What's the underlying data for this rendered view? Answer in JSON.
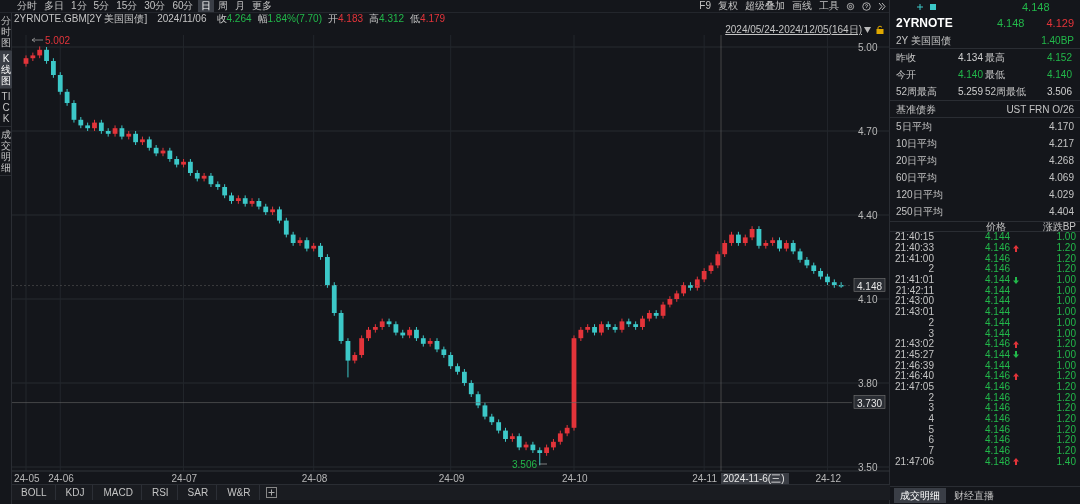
{
  "toolbar": {
    "periods": [
      {
        "label": "分时",
        "selected": false
      },
      {
        "label": "多日",
        "selected": false
      },
      {
        "label": "1分",
        "selected": false
      },
      {
        "label": "5分",
        "selected": false
      },
      {
        "label": "15分",
        "selected": false
      },
      {
        "label": "30分",
        "selected": false
      },
      {
        "label": "60分",
        "selected": false
      },
      {
        "label": "日",
        "selected": true
      },
      {
        "label": "周",
        "selected": false
      },
      {
        "label": "月",
        "selected": false
      },
      {
        "label": "更多",
        "selected": false
      }
    ],
    "tools": [
      "F9",
      "复权",
      "超级叠加",
      "画线",
      "工具"
    ]
  },
  "side_tabs": [
    {
      "label": "分时图",
      "selected": false
    },
    {
      "label": "K线图",
      "selected": true
    },
    {
      "label": "TICK",
      "selected": false
    },
    {
      "label": "成交明细",
      "selected": false
    }
  ],
  "quote_line": {
    "symbol": "2YRNOTE.GBM[2Y 美国国债]",
    "date": "2024/11/06",
    "fields": [
      {
        "label": "收",
        "value": "4.264",
        "color": "#22b84a"
      },
      {
        "label": "幅",
        "value": "1.84%(7.70)",
        "color": "#22b84a"
      },
      {
        "label": "开",
        "value": "4.183",
        "color": "#e3343a"
      },
      {
        "label": "高",
        "value": "4.312",
        "color": "#22b84a"
      },
      {
        "label": "低",
        "value": "4.179",
        "color": "#e3343a"
      }
    ]
  },
  "range_label": "2024/05/24-2024/12/05(164日)",
  "chart": {
    "chart_data": {
      "type": "candlestick",
      "categories": [
        "24-05",
        null,
        null,
        null,
        null,
        "24-06",
        null,
        null,
        null,
        null,
        null,
        null,
        null,
        null,
        null,
        null,
        null,
        null,
        null,
        null,
        null,
        null,
        null,
        "24-07",
        null,
        null,
        null,
        null,
        null,
        null,
        null,
        null,
        null,
        null,
        null,
        null,
        null,
        null,
        null,
        null,
        null,
        null,
        "24-08",
        null,
        null,
        null,
        null,
        null,
        null,
        null,
        null,
        null,
        null,
        null,
        null,
        null,
        null,
        null,
        null,
        null,
        null,
        null,
        "24-09",
        null,
        null,
        null,
        null,
        null,
        null,
        null,
        null,
        null,
        null,
        null,
        null,
        null,
        null,
        null,
        null,
        null,
        "24-10",
        null,
        null,
        null,
        null,
        null,
        null,
        null,
        null,
        null,
        null,
        null,
        null,
        null,
        null,
        null,
        null,
        null,
        null,
        "24-11",
        null,
        null,
        null,
        null,
        null,
        null,
        null,
        null,
        null,
        null,
        null,
        null,
        null,
        null,
        null,
        null,
        null,
        "24-12",
        null,
        null
      ],
      "ohlc": [
        [
          4.94,
          4.97,
          4.93,
          4.96
        ],
        [
          4.96,
          4.98,
          4.95,
          4.97
        ],
        [
          4.97,
          5.002,
          4.96,
          4.99
        ],
        [
          4.99,
          5.0,
          4.94,
          4.95
        ],
        [
          4.95,
          4.96,
          4.89,
          4.9
        ],
        [
          4.9,
          4.91,
          4.83,
          4.84
        ],
        [
          4.84,
          4.85,
          4.79,
          4.8
        ],
        [
          4.8,
          4.81,
          4.73,
          4.74
        ],
        [
          4.74,
          4.75,
          4.71,
          4.72
        ],
        [
          4.72,
          4.73,
          4.7,
          4.71
        ],
        [
          4.71,
          4.74,
          4.7,
          4.73
        ],
        [
          4.73,
          4.74,
          4.69,
          4.7
        ],
        [
          4.7,
          4.71,
          4.68,
          4.69
        ],
        [
          4.69,
          4.72,
          4.68,
          4.71
        ],
        [
          4.71,
          4.72,
          4.67,
          4.68
        ],
        [
          4.68,
          4.7,
          4.67,
          4.69
        ],
        [
          4.69,
          4.7,
          4.65,
          4.66
        ],
        [
          4.66,
          4.68,
          4.65,
          4.67
        ],
        [
          4.67,
          4.68,
          4.63,
          4.64
        ],
        [
          4.64,
          4.65,
          4.61,
          4.62
        ],
        [
          4.62,
          4.64,
          4.61,
          4.63
        ],
        [
          4.63,
          4.64,
          4.59,
          4.6
        ],
        [
          4.6,
          4.61,
          4.57,
          4.58
        ],
        [
          4.58,
          4.6,
          4.57,
          4.59
        ],
        [
          4.59,
          4.6,
          4.54,
          4.55
        ],
        [
          4.55,
          4.56,
          4.52,
          4.53
        ],
        [
          4.53,
          4.55,
          4.52,
          4.54
        ],
        [
          4.54,
          4.55,
          4.5,
          4.51
        ],
        [
          4.51,
          4.52,
          4.49,
          4.5
        ],
        [
          4.5,
          4.51,
          4.46,
          4.47
        ],
        [
          4.47,
          4.48,
          4.44,
          4.45
        ],
        [
          4.45,
          4.47,
          4.44,
          4.46
        ],
        [
          4.46,
          4.47,
          4.43,
          4.44
        ],
        [
          4.44,
          4.46,
          4.43,
          4.45
        ],
        [
          4.45,
          4.46,
          4.42,
          4.43
        ],
        [
          4.43,
          4.44,
          4.4,
          4.41
        ],
        [
          4.41,
          4.43,
          4.4,
          4.42
        ],
        [
          4.42,
          4.43,
          4.37,
          4.38
        ],
        [
          4.38,
          4.39,
          4.32,
          4.33
        ],
        [
          4.33,
          4.34,
          4.29,
          4.3
        ],
        [
          4.3,
          4.32,
          4.29,
          4.31
        ],
        [
          4.31,
          4.32,
          4.27,
          4.28
        ],
        [
          4.28,
          4.3,
          4.27,
          4.29
        ],
        [
          4.29,
          4.3,
          4.24,
          4.25
        ],
        [
          4.25,
          4.26,
          4.14,
          4.15
        ],
        [
          4.15,
          4.16,
          4.04,
          4.05
        ],
        [
          4.05,
          4.06,
          3.94,
          3.95
        ],
        [
          3.95,
          3.96,
          3.82,
          3.88
        ],
        [
          3.88,
          3.91,
          3.87,
          3.9
        ],
        [
          3.9,
          3.97,
          3.89,
          3.96
        ],
        [
          3.96,
          4.0,
          3.95,
          3.99
        ],
        [
          3.99,
          4.01,
          3.98,
          4.0
        ],
        [
          4.0,
          4.03,
          3.99,
          4.02
        ],
        [
          4.02,
          4.03,
          4.0,
          4.01
        ],
        [
          4.01,
          4.02,
          3.97,
          3.98
        ],
        [
          3.98,
          3.99,
          3.96,
          3.97
        ],
        [
          3.97,
          4.0,
          3.96,
          3.99
        ],
        [
          3.99,
          4.0,
          3.95,
          3.96
        ],
        [
          3.96,
          3.97,
          3.93,
          3.94
        ],
        [
          3.94,
          3.96,
          3.93,
          3.95
        ],
        [
          3.95,
          3.96,
          3.91,
          3.92
        ],
        [
          3.92,
          3.93,
          3.89,
          3.9
        ],
        [
          3.9,
          3.91,
          3.85,
          3.86
        ],
        [
          3.86,
          3.87,
          3.83,
          3.84
        ],
        [
          3.84,
          3.85,
          3.79,
          3.8
        ],
        [
          3.8,
          3.81,
          3.75,
          3.76
        ],
        [
          3.76,
          3.77,
          3.71,
          3.72
        ],
        [
          3.72,
          3.73,
          3.67,
          3.68
        ],
        [
          3.68,
          3.69,
          3.65,
          3.66
        ],
        [
          3.66,
          3.67,
          3.62,
          3.63
        ],
        [
          3.63,
          3.64,
          3.59,
          3.6
        ],
        [
          3.6,
          3.62,
          3.59,
          3.61
        ],
        [
          3.61,
          3.62,
          3.56,
          3.57
        ],
        [
          3.57,
          3.59,
          3.56,
          3.58
        ],
        [
          3.58,
          3.59,
          3.55,
          3.56
        ],
        [
          3.56,
          3.57,
          3.506,
          3.55
        ],
        [
          3.55,
          3.58,
          3.54,
          3.57
        ],
        [
          3.57,
          3.6,
          3.56,
          3.59
        ],
        [
          3.59,
          3.63,
          3.58,
          3.62
        ],
        [
          3.62,
          3.65,
          3.61,
          3.64
        ],
        [
          3.64,
          3.97,
          3.63,
          3.96
        ],
        [
          3.96,
          4.0,
          3.95,
          3.99
        ],
        [
          3.99,
          4.01,
          3.98,
          4.0
        ],
        [
          4.0,
          4.01,
          3.97,
          3.98
        ],
        [
          3.98,
          4.02,
          3.97,
          4.01
        ],
        [
          4.01,
          4.02,
          3.99,
          4.0
        ],
        [
          4.0,
          4.01,
          3.98,
          3.99
        ],
        [
          3.99,
          4.03,
          3.98,
          4.02
        ],
        [
          4.02,
          4.03,
          4.0,
          4.01
        ],
        [
          4.01,
          4.02,
          3.99,
          4.0
        ],
        [
          4.0,
          4.04,
          3.99,
          4.03
        ],
        [
          4.03,
          4.06,
          4.02,
          4.05
        ],
        [
          4.05,
          4.06,
          4.03,
          4.04
        ],
        [
          4.04,
          4.09,
          4.03,
          4.08
        ],
        [
          4.08,
          4.11,
          4.07,
          4.1
        ],
        [
          4.1,
          4.13,
          4.09,
          4.12
        ],
        [
          4.12,
          4.16,
          4.11,
          4.15
        ],
        [
          4.15,
          4.16,
          4.13,
          4.14
        ],
        [
          4.14,
          4.18,
          4.13,
          4.17
        ],
        [
          4.17,
          4.21,
          4.16,
          4.2
        ],
        [
          4.2,
          4.23,
          4.19,
          4.22
        ],
        [
          4.22,
          4.27,
          4.21,
          4.26
        ],
        [
          4.26,
          4.31,
          4.25,
          4.3
        ],
        [
          4.3,
          4.34,
          4.29,
          4.33
        ],
        [
          4.33,
          4.34,
          4.29,
          4.3
        ],
        [
          4.3,
          4.33,
          4.29,
          4.32
        ],
        [
          4.32,
          4.36,
          4.31,
          4.35
        ],
        [
          4.35,
          4.36,
          4.28,
          4.29
        ],
        [
          4.29,
          4.31,
          4.28,
          4.3
        ],
        [
          4.3,
          4.32,
          4.29,
          4.31
        ],
        [
          4.31,
          4.32,
          4.27,
          4.28
        ],
        [
          4.28,
          4.31,
          4.27,
          4.3
        ],
        [
          4.3,
          4.31,
          4.26,
          4.27
        ],
        [
          4.27,
          4.28,
          4.23,
          4.24
        ],
        [
          4.24,
          4.25,
          4.21,
          4.22
        ],
        [
          4.22,
          4.23,
          4.19,
          4.2
        ],
        [
          4.2,
          4.21,
          4.17,
          4.18
        ],
        [
          4.18,
          4.19,
          4.15,
          4.16
        ],
        [
          4.16,
          4.17,
          4.14,
          4.15
        ],
        [
          4.15,
          4.16,
          4.14,
          4.148
        ]
      ],
      "ylim": [
        3.5,
        5.0
      ],
      "yticks": [
        {
          "value": 5.0,
          "label": "5.00"
        },
        {
          "value": 4.7,
          "label": "4.70"
        },
        {
          "value": 4.4,
          "label": "4.40"
        },
        {
          "value": 4.1,
          "label": "4.10"
        },
        {
          "value": 3.8,
          "label": "3.80"
        },
        {
          "value": 3.5,
          "label": "3.50"
        }
      ],
      "grid": true,
      "ref_lines": [
        {
          "axis": "y",
          "value": 4.148,
          "label": "4.148"
        },
        {
          "axis": "y",
          "value": 3.73,
          "label": "3.730"
        }
      ]
    },
    "high_marker": "5.002",
    "low_marker": "3.506",
    "cursor_date": "2024-11-6(三)"
  },
  "indicator_tabs": [
    "BOLL",
    "KDJ",
    "MACD",
    "RSI",
    "SAR",
    "W&R"
  ],
  "quote": {
    "header_price": "4.148",
    "name": "2YRNOTE",
    "bid": "4.148",
    "ask": "4.129",
    "subtitle": "2Y 美国国债",
    "change": "1.40BP"
  },
  "stats": [
    {
      "label": "昨收",
      "value": "4.134",
      "highlighted": false
    },
    {
      "label": "最高",
      "value": "4.152",
      "highlighted": true
    },
    {
      "label": "今开",
      "value": "4.140",
      "highlighted": true
    },
    {
      "label": "最低",
      "value": "4.140",
      "highlighted": true
    },
    {
      "label": "52周最高",
      "value": "5.259",
      "highlighted": false
    },
    {
      "label": "52周最低",
      "value": "3.506",
      "highlighted": false
    }
  ],
  "benchmark": {
    "label": "基准债券",
    "value": "UST FRN O/26"
  },
  "averages": [
    {
      "label": "5日平均",
      "value": "4.170"
    },
    {
      "label": "10日平均",
      "value": "4.217"
    },
    {
      "label": "20日平均",
      "value": "4.268"
    },
    {
      "label": "60日平均",
      "value": "4.069"
    },
    {
      "label": "120日平均",
      "value": "4.029"
    },
    {
      "label": "250日平均",
      "value": "4.404"
    }
  ],
  "trades": {
    "columns": [
      "价格",
      "涨跌BP"
    ],
    "rows": [
      {
        "time": "21:40:15",
        "price": "4.144",
        "up": false,
        "down": false,
        "change": "1.00"
      },
      {
        "time": "21:40:33",
        "price": "4.146",
        "up": true,
        "down": false,
        "change": "1.20"
      },
      {
        "time": "21:41:00",
        "price": "4.146",
        "up": false,
        "down": false,
        "change": "1.20"
      },
      {
        "time": "2",
        "price": "4.146",
        "up": false,
        "down": false,
        "change": "1.20"
      },
      {
        "time": "21:41:01",
        "price": "4.144",
        "up": false,
        "down": true,
        "change": "1.00"
      },
      {
        "time": "21:42:11",
        "price": "4.144",
        "up": false,
        "down": false,
        "change": "1.00"
      },
      {
        "time": "21:43:00",
        "price": "4.144",
        "up": false,
        "down": false,
        "change": "1.00"
      },
      {
        "time": "21:43:01",
        "price": "4.144",
        "up": false,
        "down": false,
        "change": "1.00"
      },
      {
        "time": "2",
        "price": "4.144",
        "up": false,
        "down": false,
        "change": "1.00"
      },
      {
        "time": "3",
        "price": "4.144",
        "up": false,
        "down": false,
        "change": "1.00"
      },
      {
        "time": "21:43:02",
        "price": "4.146",
        "up": true,
        "down": false,
        "change": "1.20"
      },
      {
        "time": "21:45:27",
        "price": "4.144",
        "up": false,
        "down": true,
        "change": "1.00"
      },
      {
        "time": "21:46:39",
        "price": "4.144",
        "up": false,
        "down": false,
        "change": "1.00"
      },
      {
        "time": "21:46:40",
        "price": "4.146",
        "up": true,
        "down": false,
        "change": "1.20"
      },
      {
        "time": "21:47:05",
        "price": "4.146",
        "up": false,
        "down": false,
        "change": "1.20"
      },
      {
        "time": "2",
        "price": "4.146",
        "up": false,
        "down": false,
        "change": "1.20"
      },
      {
        "time": "3",
        "price": "4.146",
        "up": false,
        "down": false,
        "change": "1.20"
      },
      {
        "time": "4",
        "price": "4.146",
        "up": false,
        "down": false,
        "change": "1.20"
      },
      {
        "time": "5",
        "price": "4.146",
        "up": false,
        "down": false,
        "change": "1.20"
      },
      {
        "time": "6",
        "price": "4.146",
        "up": false,
        "down": false,
        "change": "1.20"
      },
      {
        "time": "7",
        "price": "4.146",
        "up": false,
        "down": false,
        "change": "1.20"
      },
      {
        "time": "21:47:06",
        "price": "4.148",
        "up": true,
        "down": false,
        "change": "1.40"
      }
    ]
  },
  "bottom_tabs": [
    {
      "label": "成交明细",
      "selected": true
    },
    {
      "label": "财经直播",
      "selected": false
    }
  ]
}
